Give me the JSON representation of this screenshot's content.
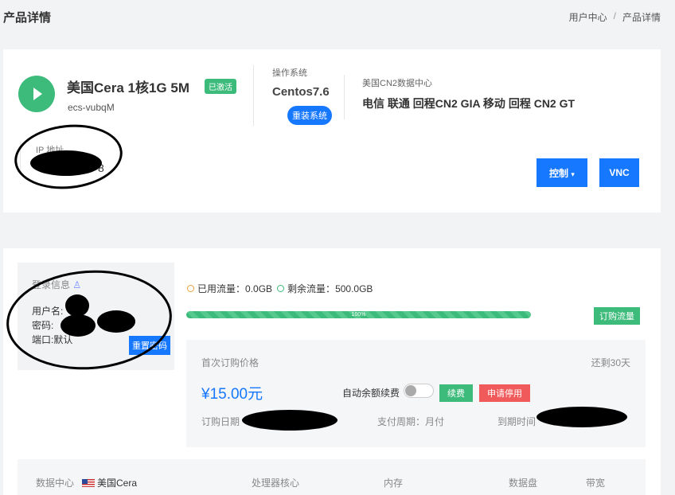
{
  "page": {
    "title": "产品详情"
  },
  "breadcrumb": {
    "home": "用户中心",
    "separator": "/",
    "current": "产品详情"
  },
  "product": {
    "name": "美国Cera 1核1G 5M",
    "status_badge": "已激活",
    "hostname": "ecs-vubqM",
    "os_label": "操作系统",
    "os_value": "Centos7.6",
    "reinstall_label": "重装系统",
    "datacenter_label": "美国CN2数据中心",
    "datacenter_lines": "电信 联通 回程CN2 GIA 移动 回程 CN2 GT",
    "ip_label": "IP 地址",
    "ip_visible": "8",
    "control_label": "控制",
    "vnc_label": "VNC"
  },
  "login": {
    "title": "登录信息",
    "username_label": "用户名:",
    "password_label": "密码:",
    "port_label": "端口:",
    "port_value": "默认",
    "reset_label": "重置密码"
  },
  "traffic": {
    "used_label": "已用流量：",
    "used_value": "0.0GB",
    "remain_label": "剩余流量：",
    "remain_value": "500.0GB",
    "progress_text": "100%",
    "progress_fraction": 1.0,
    "buy_label": "订购流量"
  },
  "billing": {
    "first_price_label": "首次订购价格",
    "remaining": "还剩30天",
    "price": "¥15.00元",
    "auto_renew_label": "自动余额续费",
    "auto_renew_on": false,
    "renew_label": "续费",
    "stop_label": "申请停用",
    "order_date_label": "订购日期",
    "cycle_label": "支付周期：",
    "cycle_value": "月付",
    "expiry_label": "到期时间"
  },
  "specs": {
    "datacenter_label": "数据中心",
    "datacenter_value": "美国Cera",
    "cpu_label": "处理器核心",
    "memory_label": "内存",
    "disk_label": "数据盘",
    "bandwidth_label": "带宽"
  },
  "colors": {
    "primary": "#1677ff",
    "success": "#3dbb7b",
    "danger": "#f05a5a"
  },
  "icons": [
    "play-icon",
    "user-icon",
    "chevron-down-icon",
    "us-flag-icon"
  ]
}
